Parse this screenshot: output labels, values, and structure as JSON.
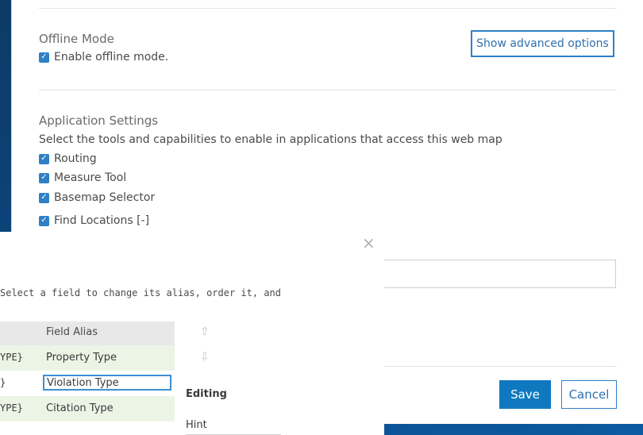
{
  "offline": {
    "title": "Offline Mode",
    "enable_label": "Enable offline mode."
  },
  "advanced_button": "Show advanced options",
  "app_settings": {
    "title": "Application Settings",
    "description": "Select the tools and capabilities to enable in applications that access this web map",
    "items": [
      {
        "label": "Routing",
        "checked": true
      },
      {
        "label": "Measure Tool",
        "checked": true
      },
      {
        "label": "Basemap Selector",
        "checked": true
      },
      {
        "label": "Find Locations [-]",
        "checked": true
      }
    ]
  },
  "footer": {
    "save": "Save",
    "cancel": "Cancel"
  },
  "dialog": {
    "close_glyph": "×",
    "description": "Select a field to change its alias, order it, and",
    "column_alias": "Field Alias",
    "rows": [
      {
        "field": "YPE}",
        "alias": "Property Type"
      },
      {
        "field": "}",
        "alias": "Violation Type"
      },
      {
        "field": "YPE}",
        "alias": "Citation Type"
      }
    ],
    "editing_title": "Editing",
    "hint_label": "Hint",
    "up_glyph": "⇧",
    "down_glyph": "⇩"
  },
  "colors": {
    "accent": "#2f80c7",
    "primary_button": "#0f79bf",
    "row_highlight": "#ecf4e6",
    "background": "#0b4d8c"
  }
}
